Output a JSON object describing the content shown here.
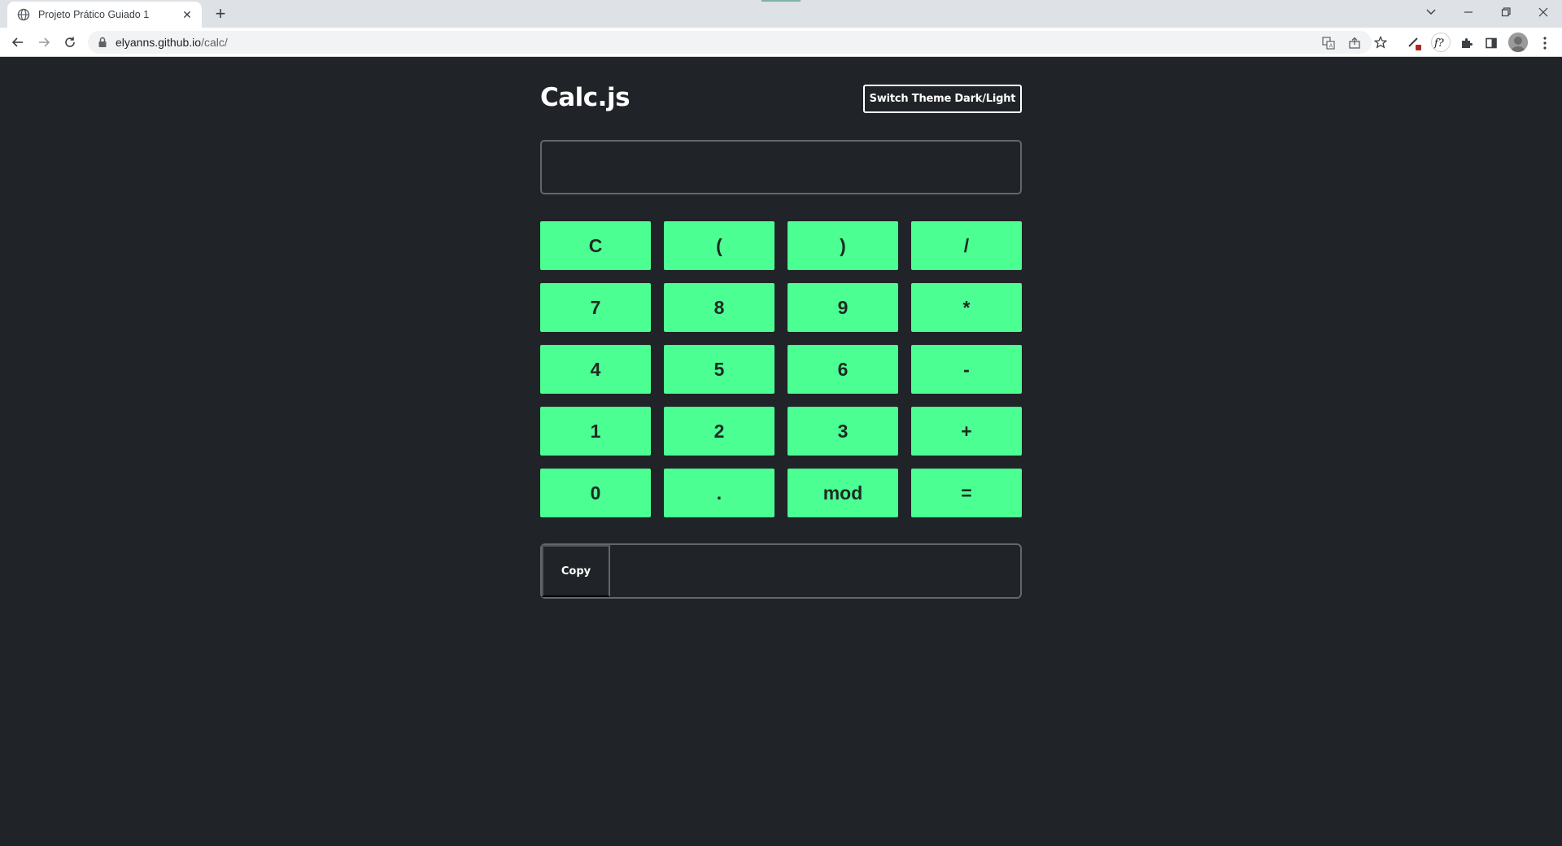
{
  "browser": {
    "tab": {
      "title": "Projeto Prático Guiado 1",
      "close": "✕",
      "favicon": "globe-icon"
    },
    "new_tab": "+",
    "url": {
      "host": "elyanns.github.io",
      "path": "/calc/"
    },
    "icons": [
      "back-arrow-icon",
      "forward-arrow-icon",
      "reload-icon",
      "lock-icon",
      "translate-icon",
      "share-icon",
      "star-icon",
      "extension-pen-icon",
      "formula-extension-icon",
      "puzzle-icon",
      "sidebar-icon",
      "profile-avatar",
      "menu-kebab-icon"
    ],
    "window_controls": {
      "dropdown": "⌄",
      "minimize": "–",
      "restore": "❐",
      "close": "✕"
    }
  },
  "app": {
    "title": "Calc.js",
    "theme_button": "Switch Theme Dark/Light",
    "display_value": "",
    "keys": [
      {
        "label": "C",
        "name": "clear-key"
      },
      {
        "label": "(",
        "name": "open-paren-key"
      },
      {
        "label": ")",
        "name": "close-paren-key"
      },
      {
        "label": "/",
        "name": "divide-key"
      },
      {
        "label": "7",
        "name": "digit-7-key"
      },
      {
        "label": "8",
        "name": "digit-8-key"
      },
      {
        "label": "9",
        "name": "digit-9-key"
      },
      {
        "label": "*",
        "name": "multiply-key"
      },
      {
        "label": "4",
        "name": "digit-4-key"
      },
      {
        "label": "5",
        "name": "digit-5-key"
      },
      {
        "label": "6",
        "name": "digit-6-key"
      },
      {
        "label": "-",
        "name": "subtract-key"
      },
      {
        "label": "1",
        "name": "digit-1-key"
      },
      {
        "label": "2",
        "name": "digit-2-key"
      },
      {
        "label": "3",
        "name": "digit-3-key"
      },
      {
        "label": "+",
        "name": "add-key"
      },
      {
        "label": "0",
        "name": "digit-0-key"
      },
      {
        "label": ".",
        "name": "decimal-key"
      },
      {
        "label": "mod",
        "name": "mod-key"
      },
      {
        "label": "=",
        "name": "equals-key"
      }
    ],
    "copy_button": "Copy",
    "result_value": ""
  },
  "colors": {
    "page_bg": "#202327",
    "key_bg": "#4bff93",
    "key_text": "#1f2a22",
    "border": "#63676c",
    "text": "#ffffff"
  }
}
